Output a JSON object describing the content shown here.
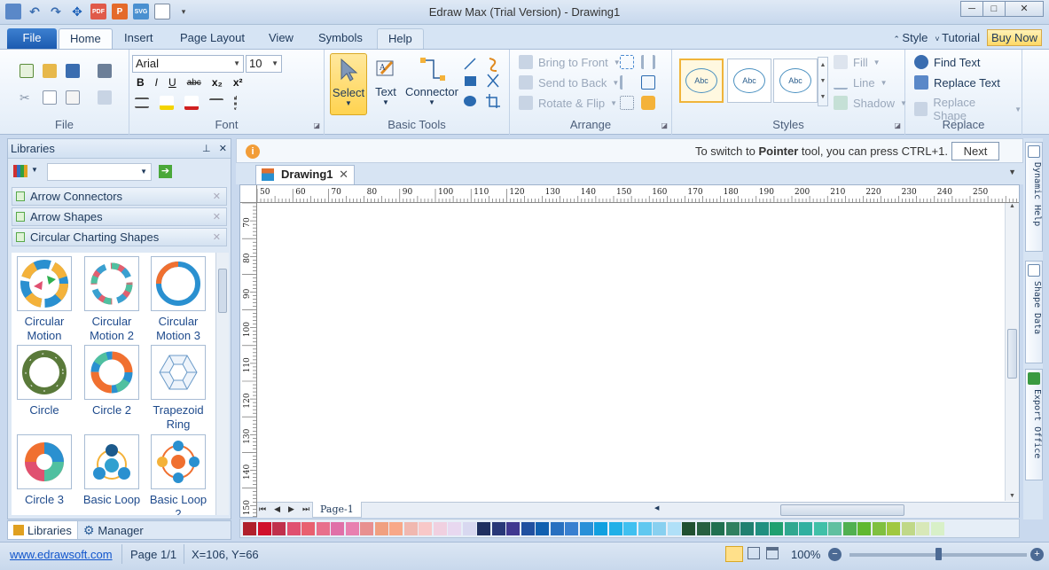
{
  "window": {
    "title": "Edraw Max (Trial Version) - Drawing1",
    "qat_labels": [
      "PDF",
      "P",
      "SVG"
    ],
    "controls": [
      "─",
      "□",
      "✕"
    ]
  },
  "tabs": {
    "file": "File",
    "items": [
      "Home",
      "Insert",
      "Page Layout",
      "View",
      "Symbols",
      "Help"
    ],
    "style": "Style",
    "tutorial": "Tutorial",
    "buy_now": "Buy Now"
  },
  "ribbon": {
    "file_group": "File",
    "font_group": "Font",
    "font_name": "Arial",
    "font_size": "10",
    "basic_tools_group": "Basic Tools",
    "select": "Select",
    "text": "Text",
    "connector": "Connector",
    "arrange_group": "Arrange",
    "bring_to_front": "Bring to Front",
    "send_to_back": "Send to Back",
    "rotate_flip": "Rotate & Flip",
    "styles_group": "Styles",
    "style_thumb_label": "Abc",
    "fill": "Fill",
    "line": "Line",
    "shadow": "Shadow",
    "replace_group": "Replace",
    "find_text": "Find Text",
    "replace_text": "Replace Text",
    "replace_shape": "Replace Shape"
  },
  "libraries": {
    "title": "Libraries",
    "categories": [
      "Arrow Connectors",
      "Arrow Shapes",
      "Circular Charting Shapes"
    ],
    "shapes": [
      "Circular Motion",
      "Circular Motion 2",
      "Circular Motion 3",
      "Circle",
      "Circle 2",
      "Trapezoid Ring",
      "Circle 3",
      "Basic Loop",
      "Basic Loop 2"
    ],
    "footer_tabs": [
      "Libraries",
      "Manager"
    ]
  },
  "infobar": {
    "message_pre": "To switch to ",
    "message_bold": "Pointer",
    "message_post": " tool, you can press CTRL+1.",
    "next": "Next"
  },
  "document": {
    "tab": "Drawing1",
    "page_tab": "Page-1",
    "hruler_labels": [
      "50",
      "60",
      "70",
      "80",
      "90",
      "100",
      "110",
      "120",
      "130",
      "140",
      "150",
      "160",
      "170",
      "180",
      "190",
      "200",
      "210",
      "220",
      "230",
      "240",
      "250"
    ],
    "vruler_labels": [
      "70",
      "80",
      "90",
      "100",
      "110",
      "120",
      "130",
      "140",
      "150"
    ]
  },
  "side_tabs": [
    "Dynamic Help",
    "Shape Data",
    "Export Office"
  ],
  "palette": [
    "#b0202c",
    "#d0102c",
    "#c0304c",
    "#e05070",
    "#e86070",
    "#e8708c",
    "#e070a8",
    "#e880b0",
    "#e89090",
    "#f0a080",
    "#f8a888",
    "#f0b8b0",
    "#f8c8c8",
    "#f0d0e0",
    "#e8d8f0",
    "#d8d8f0",
    "#203060",
    "#283878",
    "#403890",
    "#2050a0",
    "#1060b0",
    "#2870c0",
    "#3880d0",
    "#2890d8",
    "#10a0e0",
    "#20b0e8",
    "#40c0f0",
    "#60c8f0",
    "#88d0f0",
    "#b0e0f8",
    "#205030",
    "#286040",
    "#207050",
    "#308060",
    "#208070",
    "#209080",
    "#20a070",
    "#30a890",
    "#30b0a0",
    "#40c0a8",
    "#60c0a0",
    "#50b050",
    "#60b830",
    "#80c040",
    "#a0c840",
    "#c0d888",
    "#d8e8b8",
    "#d8f0c8"
  ],
  "status": {
    "website": "www.edrawsoft.com",
    "page": "Page 1/1",
    "coords": "X=106, Y=66",
    "zoom": "100%"
  }
}
